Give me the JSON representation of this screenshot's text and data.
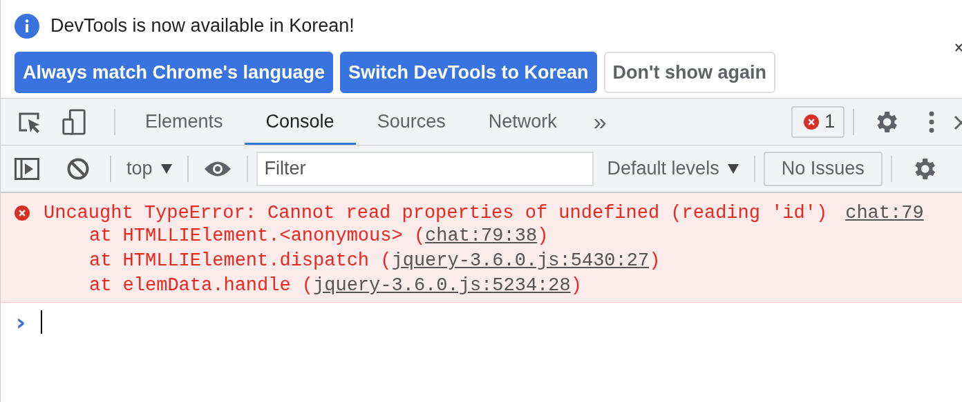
{
  "infobar": {
    "message": "DevTools is now available in Korean!",
    "buttons": [
      {
        "label": "Always match Chrome's language",
        "kind": "primary"
      },
      {
        "label": "Switch DevTools to Korean",
        "kind": "primary"
      },
      {
        "label": "Don't show again",
        "kind": "secondary"
      }
    ]
  },
  "tabs": [
    {
      "label": "Elements",
      "selected": false
    },
    {
      "label": "Console",
      "selected": true
    },
    {
      "label": "Sources",
      "selected": false
    },
    {
      "label": "Network",
      "selected": false
    }
  ],
  "more_tabs": "»",
  "error_count": "1",
  "console_toolbar": {
    "context": "top",
    "filter_placeholder": "Filter",
    "levels": "Default levels",
    "issues": "No Issues"
  },
  "messages": [
    {
      "kind": "error",
      "text": "Uncaught TypeError: Cannot read properties of undefined (reading 'id')",
      "source": "chat:79",
      "frames": [
        {
          "prefix": "at HTMLLIElement.<anonymous> (",
          "link": "chat:79:38",
          "suffix": ")"
        },
        {
          "prefix": "at HTMLLIElement.dispatch (",
          "link": "jquery-3.6.0.js:5430:27",
          "suffix": ")"
        },
        {
          "prefix": "at elemData.handle (",
          "link": "jquery-3.6.0.js:5234:28",
          "suffix": ")"
        }
      ]
    }
  ],
  "prompt": "›"
}
